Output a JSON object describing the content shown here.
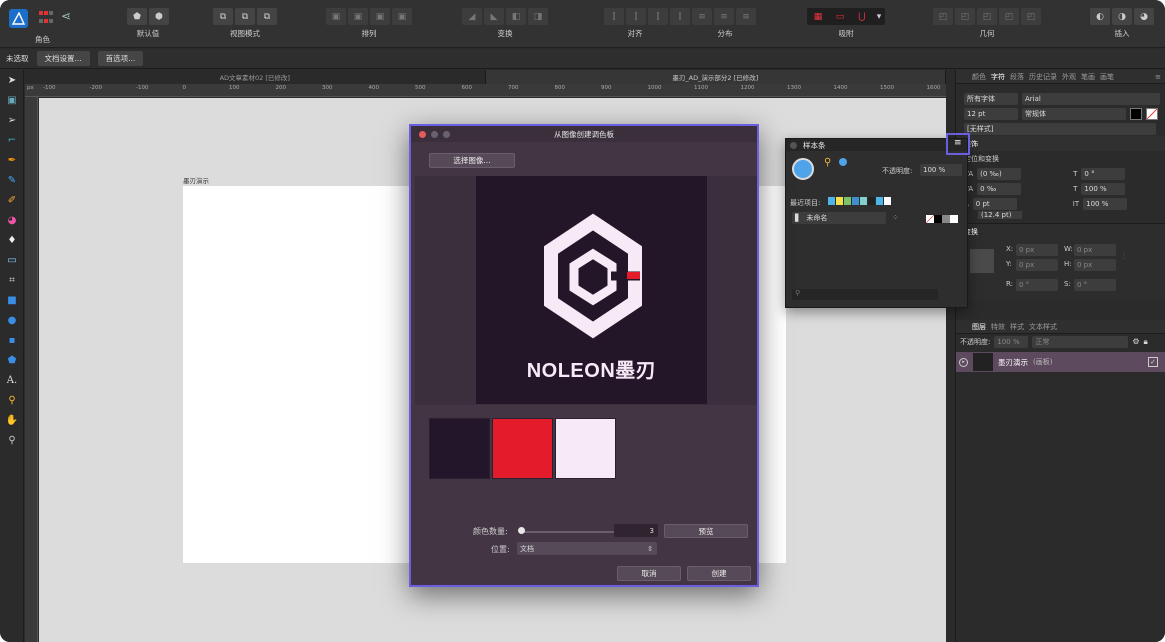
{
  "toolbar": {
    "persona_label": "角色",
    "groups": [
      {
        "label": "默认值"
      },
      {
        "label": "视图模式"
      },
      {
        "label": "排列"
      },
      {
        "label": "变换"
      },
      {
        "label": "对齐"
      },
      {
        "label": "分布"
      },
      {
        "label": "吸附"
      },
      {
        "label": "几何"
      },
      {
        "label": "插入"
      }
    ]
  },
  "context_bar": {
    "status": "未选取",
    "doc_settings": "文档设置...",
    "preferences": "首选项..."
  },
  "doc_tabs": [
    {
      "title": "AD文章素材02 [已修改]",
      "active": false
    },
    {
      "title": "墨刃_AD_演示部分2 [已修改]",
      "active": true
    }
  ],
  "ruler": {
    "unit": "px",
    "ticks": [
      "-100",
      "-200",
      "-100",
      "0",
      "100",
      "200",
      "300",
      "400",
      "500",
      "600",
      "700",
      "800",
      "900",
      "1000",
      "1100",
      "1200",
      "1300",
      "1400",
      "1500",
      "1600"
    ]
  },
  "artboard": {
    "label": "墨刃演示"
  },
  "right_panel": {
    "top_tabs": [
      "颜色",
      "字符",
      "段落",
      "历史记录",
      "外观",
      "笔画",
      "画笔"
    ],
    "active_tab": "字符",
    "font_collection": "所有字体",
    "font_family": "Arial",
    "font_size": "12 pt",
    "font_style": "常规体",
    "style": "[无样式]",
    "section_decoration": "装饰",
    "section_position": "定位和变换",
    "kerning": "(0 ‰)",
    "tracking": "0 ‰",
    "baseline": "0 pt",
    "partial": "(12.4 pt)",
    "shear": "0 °",
    "scale_v": "100 %",
    "scale_h": "100 %",
    "transform_title": "变换",
    "x_label": "X:",
    "x_value": "0 px",
    "y_label": "Y:",
    "y_value": "0 px",
    "w_label": "W:",
    "w_value": "0 px",
    "h_label": "H:",
    "h_value": "0 px",
    "r_label": "R:",
    "r_value": "0 °",
    "s_label": "S:",
    "s_value": "0 °",
    "layers_tabs": [
      "图层",
      "特效",
      "样式",
      "文本样式"
    ],
    "opacity_label": "不透明度:",
    "opacity_value": "100 %",
    "blend_mode": "正常",
    "layer_name": "墨刃演示",
    "layer_type": "(画板)"
  },
  "swatches_panel": {
    "title": "样本条",
    "opacity_label": "不透明度:",
    "opacity_value": "100 %",
    "recent_label": "最近项目:",
    "palette_name": "未命名",
    "recent_colors": [
      "#4fb4e8",
      "#f4e04d",
      "#7ac36a",
      "#3e8fd1",
      "#82d0c8",
      "#222222",
      "#4fb4e8",
      "#ffffff"
    ]
  },
  "dialog": {
    "title": "从图像创建调色板",
    "select_image": "选择图像...",
    "logo_text": "NOLEON墨刃",
    "palette": [
      "#23162a",
      "#e31b2b",
      "#f7e9f6"
    ],
    "color_count_label": "颜色数量:",
    "color_count_value": "3",
    "preview_button": "预览",
    "position_label": "位置:",
    "position_value": "文档",
    "cancel_button": "取消",
    "create_button": "创建"
  },
  "colors": {
    "accent_outline": "#6a5fe0",
    "logo_red": "#e31b2b"
  }
}
